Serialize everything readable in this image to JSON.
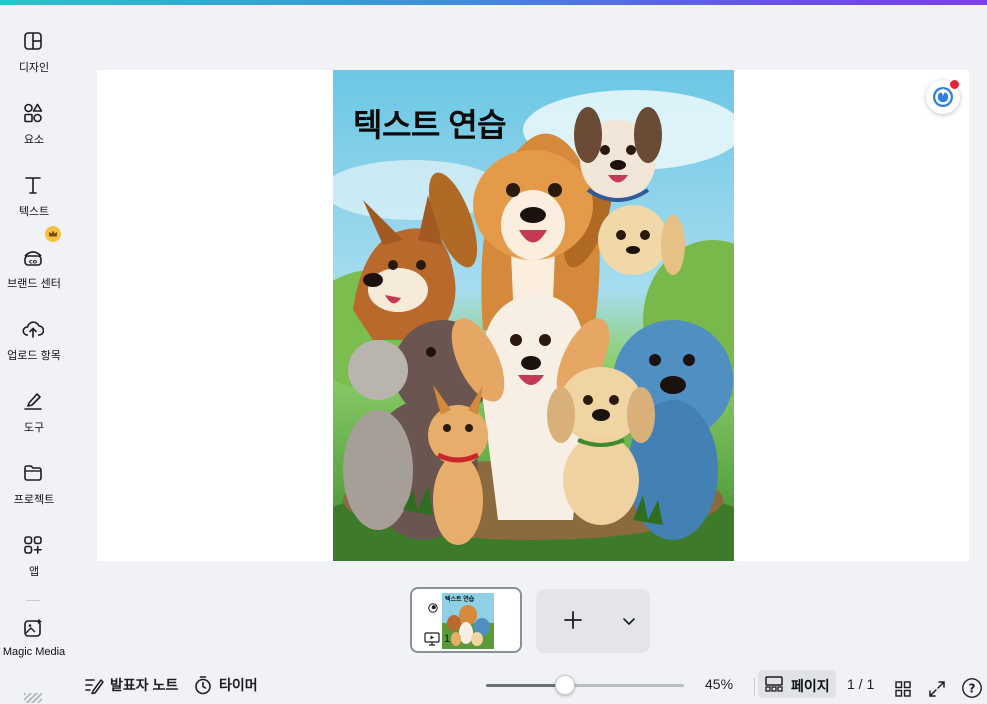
{
  "sidebar": {
    "items": [
      {
        "label": "디자인",
        "icon": "design-icon"
      },
      {
        "label": "요소",
        "icon": "elements-icon"
      },
      {
        "label": "텍스트",
        "icon": "text-icon"
      },
      {
        "label": "브랜드 센터",
        "icon": "brand-icon",
        "badge": "crown-icon"
      },
      {
        "label": "업로드 항목",
        "icon": "upload-icon"
      },
      {
        "label": "도구",
        "icon": "draw-icon"
      },
      {
        "label": "프로젝트",
        "icon": "folder-icon"
      },
      {
        "label": "앱",
        "icon": "apps-icon"
      },
      {
        "label": "Magic Media",
        "icon": "magic-media-icon"
      }
    ]
  },
  "canvas": {
    "text_element": "텍스트 연습",
    "image_description_icon": "cartoon-dogs-image"
  },
  "pages": {
    "thumbnail_number": "1",
    "thumbnail_text": "텍스트 연습"
  },
  "footer": {
    "notes_label": "발표자 노트",
    "timer_label": "타이머",
    "zoom_value": "45%",
    "zoom_fraction": 0.45,
    "zoom_slider_position": 0.4,
    "pages_label": "페이지",
    "page_count": "1 / 1"
  },
  "colors": {
    "accent_gradient_start": "#2bc2c9",
    "accent_gradient_end": "#7d3fe5",
    "background": "#f1f2f6",
    "crown_badge": "#f6c142",
    "notification_dot": "#e5213b"
  }
}
